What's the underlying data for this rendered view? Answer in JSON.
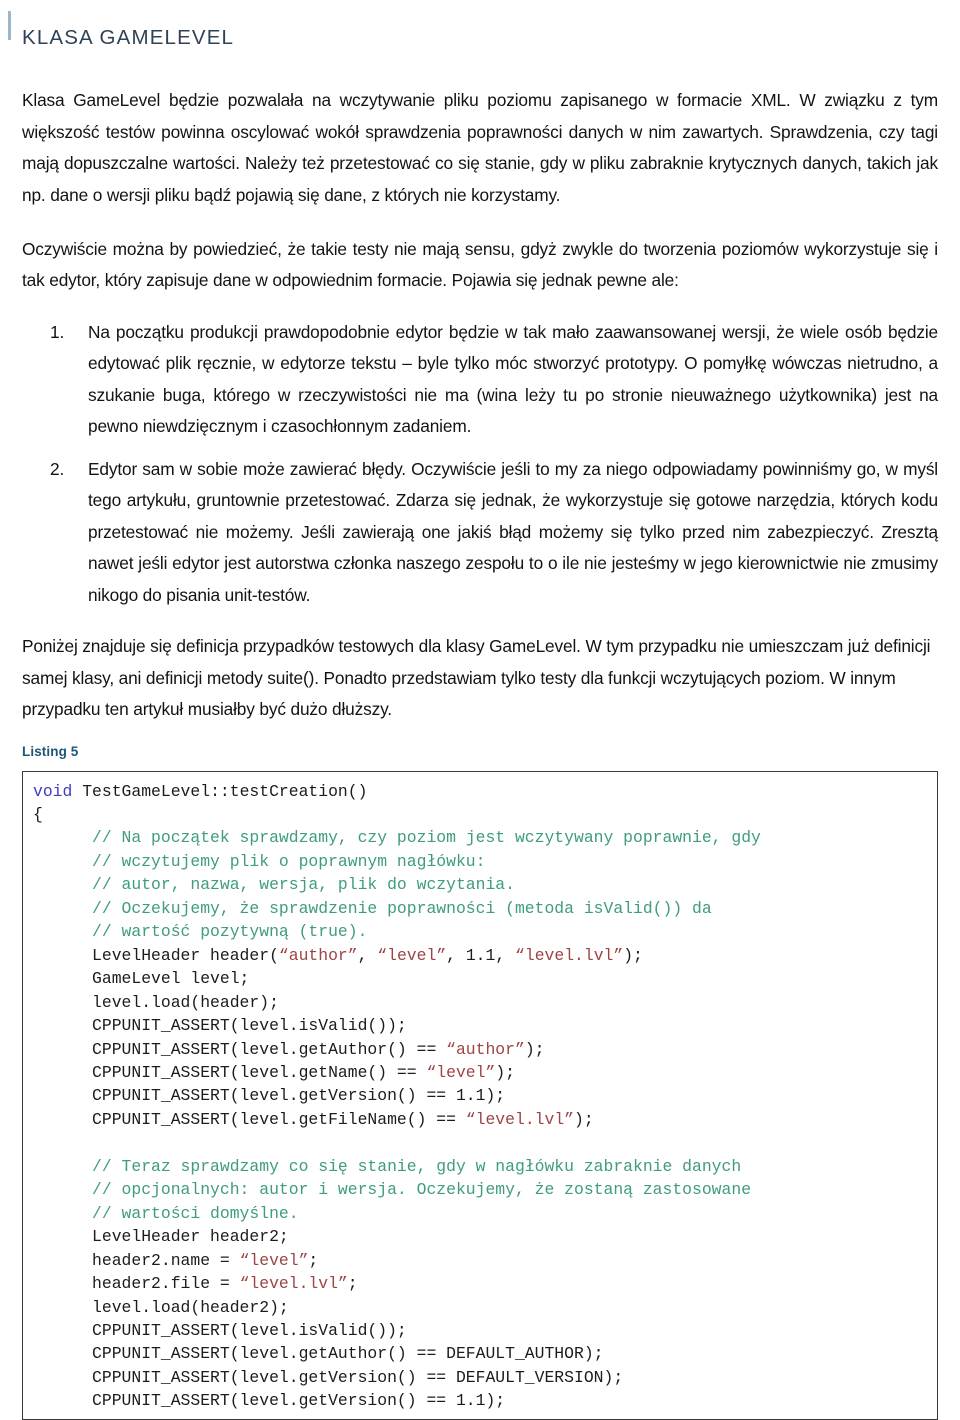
{
  "heading": {
    "title": "KLASA GAMELEVEL",
    "accent_color": "#9db7c9",
    "text_color": "#2f4256"
  },
  "paragraphs": {
    "intro": "Klasa GameLevel będzie pozwalała na wczytywanie pliku poziomu zapisanego w formacie XML. W związku z tym większość testów powinna oscylować wokół sprawdzenia poprawności danych w nim zawartych. Sprawdzenia, czy tagi mają dopuszczalne wartości. Należy też przetestować co się stanie, gdy w pliku zabraknie krytycznych danych, takich jak np. dane o wersji pliku bądź pojawią się dane, z których nie korzystamy.",
    "obvious": "Oczywiście można by powiedzieć, że takie testy nie mają sensu, gdyż zwykle do tworzenia poziomów wykorzystuje się i tak edytor, który zapisuje dane w odpowiednim formacie. Pojawia się jednak pewne ale:",
    "outro": "Poniżej znajduje się definicja przypadków testowych dla klasy GameLevel. W tym przypadku nie umieszczam już definicji samej klasy, ani definicji metody suite(). Ponadto przedstawiam tylko testy dla funkcji wczytujących poziom. W innym przypadku ten artykuł musiałby być dużo dłuższy."
  },
  "list": {
    "items": [
      {
        "number": "1.",
        "text": "Na początku produkcji prawdopodobnie edytor będzie w tak mało zaawansowanej wersji, że wiele osób będzie edytować plik ręcznie, w edytorze tekstu – byle tylko móc stworzyć prototypy. O pomyłkę wówczas nietrudno, a szukanie buga, którego w rzeczywistości nie ma (wina leży tu po stronie nieuważnego użytkownika) jest na pewno niewdzięcznym i czasochłonnym zadaniem."
      },
      {
        "number": "2.",
        "text": "Edytor sam w sobie może zawierać błędy. Oczywiście jeśli to my za niego odpowiadamy powinniśmy go, w myśl tego artykułu, gruntownie przetestować. Zdarza się jednak, że wykorzystuje się gotowe narzędzia, których kodu przetestować nie możemy. Jeśli zawierają one jakiś błąd możemy się tylko przed nim zabezpieczyć. Zresztą nawet jeśli edytor jest autorstwa członka naszego zespołu to o ile nie jesteśmy w jego kierownictwie nie zmusimy nikogo do pisania unit-testów."
      }
    ]
  },
  "listing": {
    "caption": "Listing 5",
    "caption_color": "#1f5676",
    "code_colors": {
      "keyword": "#3d3dbf",
      "comment": "#3f9c7d",
      "string": "#9e4444",
      "plain": "#1c1c1c"
    },
    "code_lines": [
      [
        {
          "t": "void",
          "c": "kw"
        },
        {
          "t": " TestGameLevel::testCreation()",
          "c": "plain"
        }
      ],
      [
        {
          "t": "{",
          "c": "plain"
        }
      ],
      [
        {
          "t": "      // Na początek sprawdzamy, czy poziom jest wczytywany poprawnie, gdy",
          "c": "comment"
        }
      ],
      [
        {
          "t": "      // wczytujemy plik o poprawnym nagłówku:",
          "c": "comment"
        }
      ],
      [
        {
          "t": "      // autor, nazwa, wersja, plik do wczytania.",
          "c": "comment"
        }
      ],
      [
        {
          "t": "      // Oczekujemy, że sprawdzenie poprawności (metoda isValid()) da",
          "c": "comment"
        }
      ],
      [
        {
          "t": "      // wartość pozytywną (true).",
          "c": "comment"
        }
      ],
      [
        {
          "t": "      LevelHeader header(",
          "c": "plain"
        },
        {
          "t": "“author”",
          "c": "str"
        },
        {
          "t": ", ",
          "c": "plain"
        },
        {
          "t": "“level”",
          "c": "str"
        },
        {
          "t": ", 1.1, ",
          "c": "plain"
        },
        {
          "t": "“level.lvl”",
          "c": "str"
        },
        {
          "t": ");",
          "c": "plain"
        }
      ],
      [
        {
          "t": "      GameLevel level;",
          "c": "plain"
        }
      ],
      [
        {
          "t": "      level.load(header);",
          "c": "plain"
        }
      ],
      [
        {
          "t": "      CPPUNIT_ASSERT(level.isValid());",
          "c": "plain"
        }
      ],
      [
        {
          "t": "      CPPUNIT_ASSERT(level.getAuthor() == ",
          "c": "plain"
        },
        {
          "t": "“author”",
          "c": "str"
        },
        {
          "t": ");",
          "c": "plain"
        }
      ],
      [
        {
          "t": "      CPPUNIT_ASSERT(level.getName() == ",
          "c": "plain"
        },
        {
          "t": "“level”",
          "c": "str"
        },
        {
          "t": ");",
          "c": "plain"
        }
      ],
      [
        {
          "t": "      CPPUNIT_ASSERT(level.getVersion() == 1.1);",
          "c": "plain"
        }
      ],
      [
        {
          "t": "      CPPUNIT_ASSERT(level.getFileName() == ",
          "c": "plain"
        },
        {
          "t": "“level.lvl”",
          "c": "str"
        },
        {
          "t": ");",
          "c": "plain"
        }
      ],
      [
        {
          "t": "",
          "c": "plain"
        }
      ],
      [
        {
          "t": "      // Teraz sprawdzamy co się stanie, gdy w nagłówku zabraknie danych",
          "c": "comment"
        }
      ],
      [
        {
          "t": "      // opcjonalnych: autor i wersja. Oczekujemy, że zostaną zastosowane",
          "c": "comment"
        }
      ],
      [
        {
          "t": "      // wartości domyślne.",
          "c": "comment"
        }
      ],
      [
        {
          "t": "      LevelHeader header2;",
          "c": "plain"
        }
      ],
      [
        {
          "t": "      header2.name = ",
          "c": "plain"
        },
        {
          "t": "“level”",
          "c": "str"
        },
        {
          "t": ";",
          "c": "plain"
        }
      ],
      [
        {
          "t": "      header2.file = ",
          "c": "plain"
        },
        {
          "t": "“level.lvl”",
          "c": "str"
        },
        {
          "t": ";",
          "c": "plain"
        }
      ],
      [
        {
          "t": "      level.load(header2);",
          "c": "plain"
        }
      ],
      [
        {
          "t": "      CPPUNIT_ASSERT(level.isValid());",
          "c": "plain"
        }
      ],
      [
        {
          "t": "      CPPUNIT_ASSERT(level.getAuthor() == DEFAULT_AUTHOR);",
          "c": "plain"
        }
      ],
      [
        {
          "t": "      CPPUNIT_ASSERT(level.getVersion() == DEFAULT_VERSION);",
          "c": "plain"
        }
      ],
      [
        {
          "t": "      CPPUNIT_ASSERT(level.getVersion() == 1.1);",
          "c": "plain"
        }
      ]
    ]
  }
}
